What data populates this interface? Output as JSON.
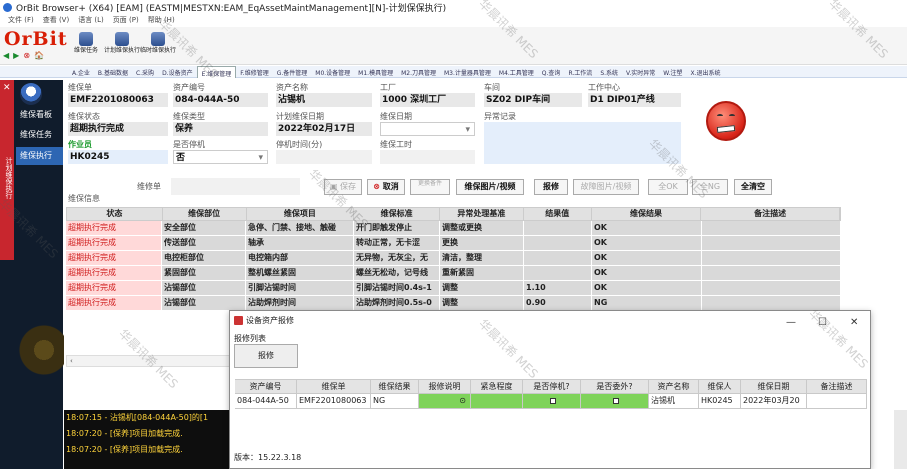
{
  "window": {
    "title": "OrBit Browser+ (X64) [EAM] (EASTM|MESTXN:EAM_EqAssetMaintManagement][N]-计划保保执行)"
  },
  "menu": [
    "文件 (F)",
    "查看 (V)",
    "语言 (L)",
    "页面 (P)",
    "帮助 (H)"
  ],
  "logo": "OrBit",
  "toolbar": [
    {
      "label": "维保任务"
    },
    {
      "label": "计划维保执行"
    },
    {
      "label": "临时维保执行"
    }
  ],
  "nav_icons": [
    "◀",
    "▶",
    "⊗",
    "🏠"
  ],
  "tabs": [
    "A.企业",
    "B.基础数据",
    "C.采购",
    "D.设备资产",
    "E.维保管理",
    "F.维修管理",
    "G.备件管理",
    "M0.设备管理",
    "M1.模具管理",
    "M2.刀具管理",
    "M3.计量器具管理",
    "M4.工具管理",
    "Q.查询",
    "R.工作流",
    "S.系统",
    "V.实时异常",
    "W.注塑",
    "X.退出系统"
  ],
  "active_tab": "E.维保管理",
  "sidebar": {
    "vertical_tab": "计划维保执行",
    "items": [
      "维保看板",
      "维保任务",
      "维保执行"
    ],
    "active": "维保执行"
  },
  "form": {
    "row1": [
      {
        "label": "维保单",
        "value": "EMF2201080063"
      },
      {
        "label": "资产编号",
        "value": "084-044A-50"
      },
      {
        "label": "资产名称",
        "value": "沾锡机"
      },
      {
        "label": "工厂",
        "value": "1000 深圳工厂"
      },
      {
        "label": "车间",
        "value": "SZ02 DIP车间"
      },
      {
        "label": "工作中心",
        "value": "D1 DIP01产线"
      }
    ],
    "row2": [
      {
        "label": "维保状态",
        "value": "超期执行完成"
      },
      {
        "label": "维保类型",
        "value": "保养"
      },
      {
        "label": "计划维保日期",
        "value": "2022年02月17日"
      },
      {
        "label": "维保日期",
        "value": ""
      },
      {
        "label": "异常记录",
        "value": ""
      }
    ],
    "row3": [
      {
        "label": "作业员",
        "value": "HK0245"
      },
      {
        "label": "是否停机",
        "value": "否"
      },
      {
        "label": "停机时间(分)",
        "value": ""
      },
      {
        "label": "维保工时",
        "value": ""
      }
    ],
    "maint_no_label": "维修单",
    "section_label": "维保信息"
  },
  "buttons": [
    {
      "label": "保存",
      "enabled": false
    },
    {
      "label": "取消",
      "enabled": true
    },
    {
      "label": "更换备件",
      "enabled": false
    },
    {
      "label": "维保图片/视频",
      "enabled": true
    },
    {
      "label": "报修",
      "enabled": true
    },
    {
      "label": "故障图片/视频",
      "enabled": false
    },
    {
      "label": "全OK",
      "enabled": false
    },
    {
      "label": "全NG",
      "enabled": false
    },
    {
      "label": "全清空",
      "enabled": true
    }
  ],
  "grid": {
    "columns": [
      "状态",
      "维保部位",
      "维保项目",
      "维保标准",
      "异常处理基准",
      "结果值",
      "维保结果",
      "备注描述"
    ],
    "rows": [
      {
        "status": "超期执行完成",
        "part": "安全部位",
        "item": "急停、门禁、接地、触碰",
        "standard": "开门即触发停止",
        "handle": "调整或更换",
        "value": "",
        "result": "OK",
        "note": ""
      },
      {
        "status": "超期执行完成",
        "part": "传送部位",
        "item": "轴承",
        "standard": "转动正常，无卡涩",
        "handle": "更换",
        "value": "",
        "result": "OK",
        "note": ""
      },
      {
        "status": "超期执行完成",
        "part": "电控柜部位",
        "item": "电控箱内部",
        "standard": "无异物，无灰尘，无",
        "handle": "清洁，整理",
        "value": "",
        "result": "OK",
        "note": ""
      },
      {
        "status": "超期执行完成",
        "part": "紧固部位",
        "item": "整机螺丝紧固",
        "standard": "螺丝无松动，记号线",
        "handle": "重新紧固",
        "value": "",
        "result": "OK",
        "note": ""
      },
      {
        "status": "超期执行完成",
        "part": "沾锡部位",
        "item": "引脚沾锡时间",
        "standard": "引脚沾锡时间0.4s-1",
        "handle": "调整",
        "value": "1.10",
        "result": "OK",
        "note": ""
      },
      {
        "status": "超期执行完成",
        "part": "沾锡部位",
        "item": "沾助焊剂时间",
        "standard": "沾助焊剂时间0.5s-0",
        "handle": "调整",
        "value": "0.90",
        "result": "NG",
        "note": ""
      }
    ]
  },
  "log": [
    "18:07:15 - 沾锡机[084-044A-50]的[1",
    "18:07:20 - [保养]项目加载完成.",
    "18:07:20 - [保养]项目加载完成."
  ],
  "dialog": {
    "title": "设备资产报修",
    "subtitle": "报修列表",
    "button": "报修",
    "columns": [
      "资产编号",
      "维保单",
      "维保结果",
      "报修说明",
      "紧急程度",
      "是否停机?",
      "是否委外?",
      "资产名称",
      "维保人",
      "维保日期",
      "备注描述"
    ],
    "row": {
      "asset": "084-044A-50",
      "order": "EMF2201080063",
      "result": "NG",
      "desc": "",
      "urgency": "",
      "stop": "",
      "outsource": "",
      "name": "沾锡机",
      "person": "HK0245",
      "date": "2022年03月20",
      "note": ""
    },
    "version": "版本：15.22.3.18"
  },
  "watermark": "华晨讯希 MES"
}
